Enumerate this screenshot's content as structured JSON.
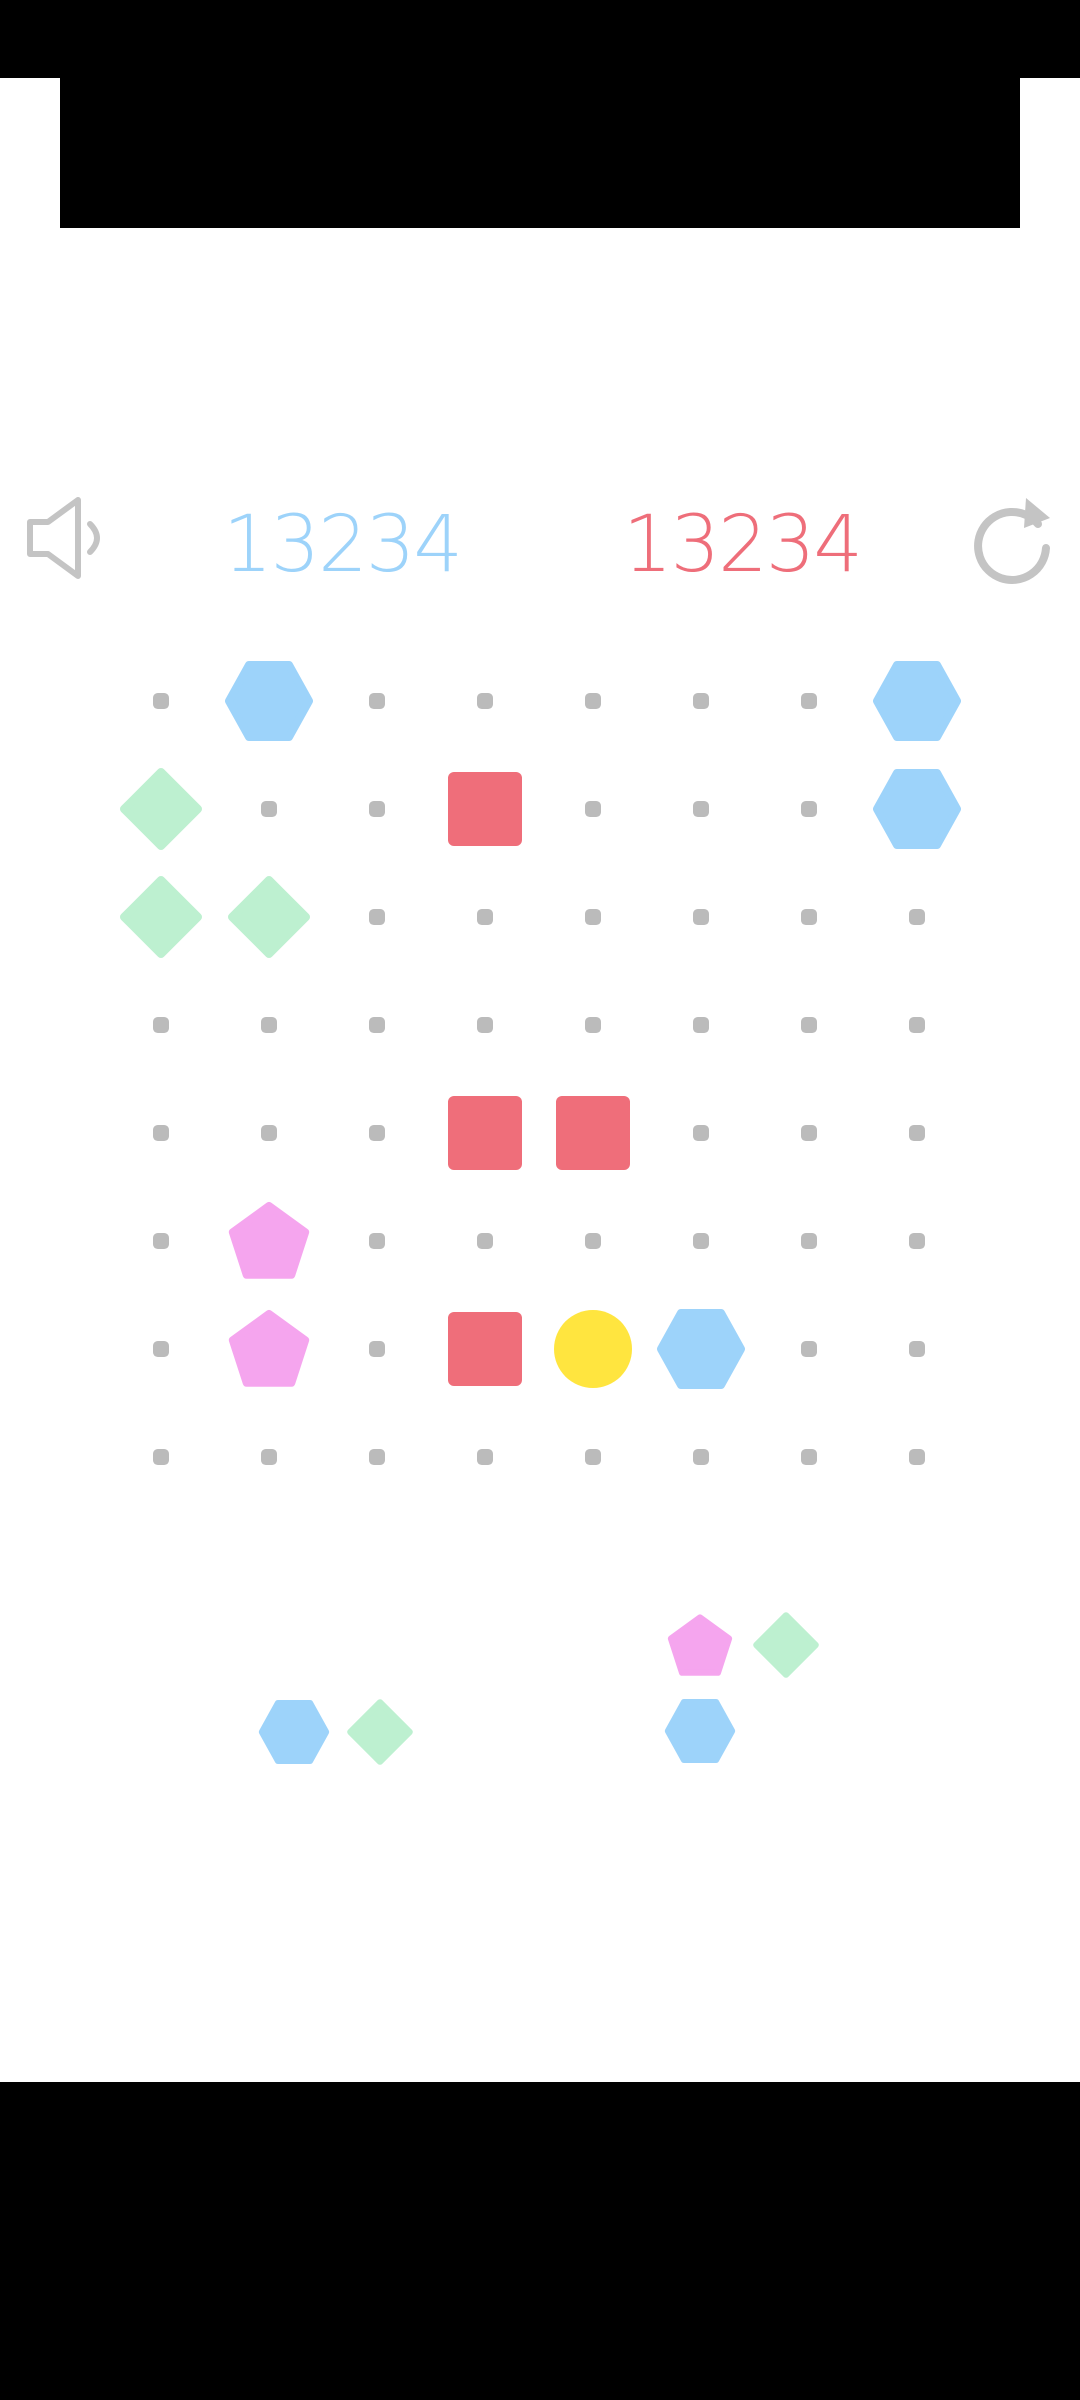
{
  "scores": {
    "current": "13234",
    "best": "13234"
  },
  "colors": {
    "blue": "#9dd3fa",
    "green": "#bdf0d0",
    "red": "#ef6e7a",
    "pink": "#f5a5ee",
    "yellow": "#ffe53f",
    "dot": "#bbbbbb",
    "icon": "#c4c4c4"
  },
  "icons": {
    "sound": "speaker-icon",
    "restart": "restart-icon"
  },
  "board": {
    "rows": 8,
    "cols": 8,
    "cells": [
      [
        "empty",
        "blue-hexagon",
        "empty",
        "empty",
        "empty",
        "empty",
        "empty",
        "blue-hexagon"
      ],
      [
        "green-diamond",
        "empty",
        "empty",
        "red-square",
        "empty",
        "empty",
        "empty",
        "blue-hexagon"
      ],
      [
        "green-diamond",
        "green-diamond",
        "empty",
        "empty",
        "empty",
        "empty",
        "empty",
        "empty"
      ],
      [
        "empty",
        "empty",
        "empty",
        "empty",
        "empty",
        "empty",
        "empty",
        "empty"
      ],
      [
        "empty",
        "empty",
        "empty",
        "red-square",
        "red-square",
        "empty",
        "empty",
        "empty"
      ],
      [
        "empty",
        "pink-pentagon",
        "empty",
        "empty",
        "empty",
        "empty",
        "empty",
        "empty"
      ],
      [
        "empty",
        "pink-pentagon",
        "empty",
        "red-square",
        "yellow-circle",
        "blue-hexagon",
        "empty",
        "empty"
      ],
      [
        "empty",
        "empty",
        "empty",
        "empty",
        "empty",
        "empty",
        "empty",
        "empty"
      ]
    ]
  },
  "pieces": [
    {
      "name": "piece-1",
      "blocks": [
        {
          "row": 0,
          "col": 0,
          "shape": "blue-hexagon"
        },
        {
          "row": 0,
          "col": 1,
          "shape": "green-diamond"
        }
      ]
    },
    {
      "name": "piece-2",
      "blocks": [
        {
          "row": 0,
          "col": 0,
          "shape": "pink-pentagon"
        },
        {
          "row": 0,
          "col": 1,
          "shape": "green-diamond"
        },
        {
          "row": 1,
          "col": 0,
          "shape": "blue-hexagon"
        }
      ]
    }
  ]
}
